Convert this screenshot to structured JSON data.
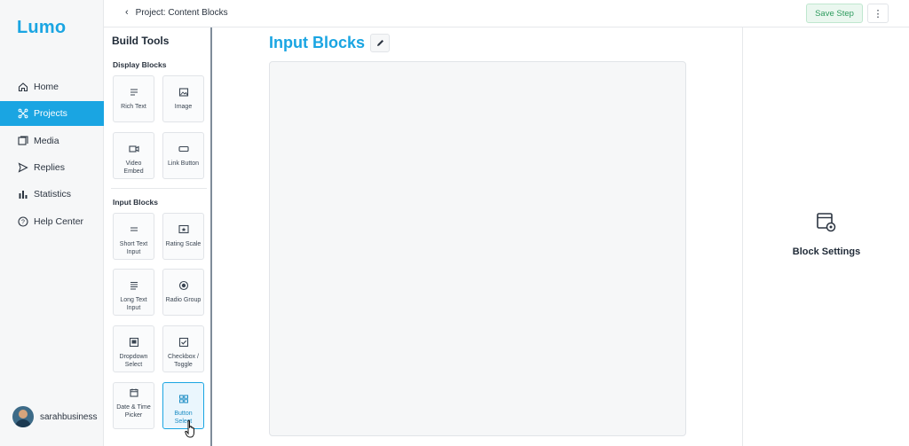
{
  "app": {
    "logo": "Lumo"
  },
  "nav": {
    "items": [
      {
        "label": "Home",
        "icon": "home-icon",
        "active": false
      },
      {
        "label": "Projects",
        "icon": "projects-icon",
        "active": true
      },
      {
        "label": "Media",
        "icon": "media-icon",
        "active": false
      },
      {
        "label": "Replies",
        "icon": "send-icon",
        "active": false
      },
      {
        "label": "Statistics",
        "icon": "bar-chart-icon",
        "active": false
      },
      {
        "label": "Help Center",
        "icon": "help-icon",
        "active": false
      }
    ],
    "user": {
      "name": "sarahbusiness"
    }
  },
  "header": {
    "breadcrumb": "Project: Content Blocks",
    "save_label": "Save Step",
    "more_label": "⋮"
  },
  "tools": {
    "title": "Build Tools",
    "display_section": "Display Blocks",
    "input_section": "Input Blocks",
    "display_blocks": [
      {
        "label": "Rich Text",
        "icon": "text-lines-icon"
      },
      {
        "label": "Image",
        "icon": "image-icon"
      },
      {
        "label": "Video Embed",
        "icon": "video-icon"
      },
      {
        "label": "Link Button",
        "icon": "link-button-icon"
      }
    ],
    "input_blocks": [
      {
        "label": "Short Text Input",
        "icon": "short-text-icon"
      },
      {
        "label": "Rating Scale",
        "icon": "rating-icon"
      },
      {
        "label": "Long Text Input",
        "icon": "long-text-icon"
      },
      {
        "label": "Radio Group",
        "icon": "radio-icon"
      },
      {
        "label": "Dropdown Select",
        "icon": "dropdown-icon"
      },
      {
        "label": "Checkbox / Toggle",
        "icon": "checkbox-icon"
      },
      {
        "label": "Date & Time Picker",
        "icon": "calendar-icon"
      },
      {
        "label": "Button Select",
        "icon": "button-select-icon",
        "selected": true
      }
    ]
  },
  "canvas": {
    "title": "Input Blocks"
  },
  "settings": {
    "label": "Block Settings"
  },
  "colors": {
    "accent": "#1aa5e2",
    "save_green": "#2f9c5f",
    "nav_bg": "#f6f7f8"
  }
}
